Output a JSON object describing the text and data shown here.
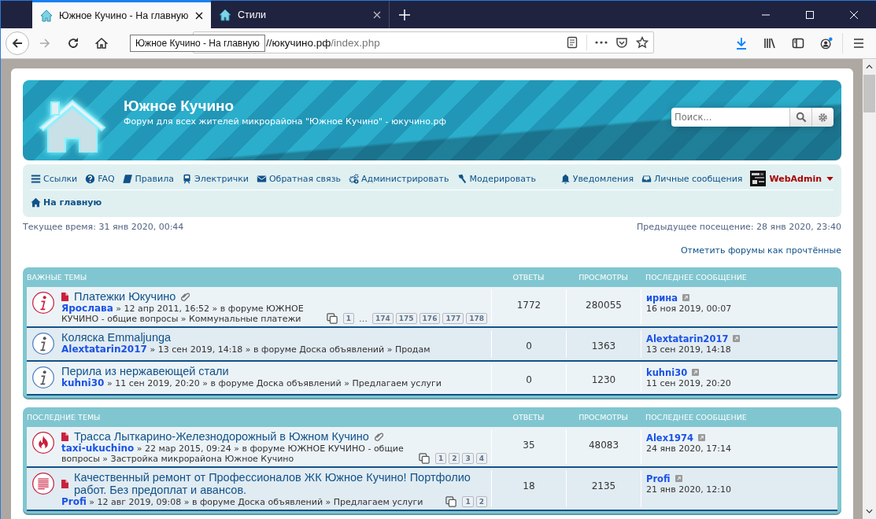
{
  "browser": {
    "tabs": [
      {
        "title": "Южное Кучино - На главную",
        "selected": true
      },
      {
        "title": "Стили",
        "selected": false
      }
    ],
    "url_host": "//юкучино.рф",
    "url_path": "/index.php",
    "tooltip": "Южное Кучино - На главную"
  },
  "site": {
    "title": "Южное Кучино",
    "subtitle": "Форум для всех жителей микрорайона \"Южное Кучино\" - юкучино.рф",
    "search_placeholder": "Поиск..."
  },
  "nav": {
    "left": [
      {
        "label": "Ссылки"
      },
      {
        "label": "FAQ"
      },
      {
        "label": "Правила"
      },
      {
        "label": "Электрички"
      },
      {
        "label": "Обратная связь"
      },
      {
        "label": "Администрировать"
      },
      {
        "label": "Модерировать"
      }
    ],
    "right": [
      {
        "label": "Уведомления"
      },
      {
        "label": "Личные сообщения"
      }
    ],
    "user": "WebAdmin",
    "breadcrumb": "На главную"
  },
  "current_time": "Текущее время: 31 янв 2020, 00:44",
  "last_visit": "Предыдущее посещение: 28 янв 2020, 23:40",
  "mark_read": "Отметить форумы как прочтённые",
  "sections": [
    {
      "title": "ВАЖНЫЕ ТЕМЫ",
      "columns": [
        "ОТВЕТЫ",
        "ПРОСМОТРЫ",
        "ПОСЛЕДНЕЕ СООБЩЕНИЕ"
      ],
      "topics": [
        {
          "kind": "info",
          "unread": true,
          "attachment": true,
          "title": "Платежки Юкучино",
          "author": "Ярослава",
          "meta": "» 12 апр 2011, 16:52 » в форуме ЮЖНОЕ КУЧИНО - общие вопросы » Коммунальные платежи",
          "pages": [
            {
              "kind": "page",
              "label": "1"
            },
            {
              "kind": "ellipsis",
              "label": "…"
            },
            {
              "kind": "page",
              "label": "174"
            },
            {
              "kind": "page",
              "label": "175"
            },
            {
              "kind": "page",
              "label": "176"
            },
            {
              "kind": "page",
              "label": "177"
            },
            {
              "kind": "page",
              "label": "178"
            }
          ],
          "replies": "1772",
          "views": "280055",
          "last_author": "ирина",
          "last_date": "16 ноя 2019, 00:07"
        },
        {
          "kind": "info",
          "unread": false,
          "attachment": false,
          "title": "Коляска Emmaljunga",
          "author": "Alextatarin2017",
          "meta": "» 13 сен 2019, 14:18 » в форуме Доска объявлений » Продам",
          "replies": "0",
          "views": "1363",
          "last_author": "Alextatarin2017",
          "last_date": "13 сен 2019, 14:18"
        },
        {
          "kind": "info",
          "unread": false,
          "attachment": false,
          "title": "Перила из нержавеющей стали",
          "author": "kuhni30",
          "meta": "» 11 сен 2019, 20:20 » в форуме Доска объявлений » Предлагаем услуги",
          "replies": "0",
          "views": "1230",
          "last_author": "kuhni30",
          "last_date": "11 сен 2019, 20:20"
        }
      ]
    },
    {
      "title": "ПОСЛЕДНИЕ ТЕМЫ",
      "columns": [
        "ОТВЕТЫ",
        "ПРОСМОТРЫ",
        "ПОСЛЕДНЕЕ СООБЩЕНИЕ"
      ],
      "topics": [
        {
          "kind": "fire",
          "unread": true,
          "attachment": true,
          "title": "Трасса Лыткарино-Железнодорожный в Южном Кучино",
          "author": "taxi-ukuchino",
          "meta": "» 22 мар 2015, 09:24 » в форуме ЮЖНОЕ КУЧИНО - общие вопросы » Застройка микрорайона Южное Кучино",
          "pages": [
            {
              "kind": "page",
              "label": "1"
            },
            {
              "kind": "page",
              "label": "2"
            },
            {
              "kind": "page",
              "label": "3"
            },
            {
              "kind": "page",
              "label": "4"
            }
          ],
          "replies": "35",
          "views": "48083",
          "last_author": "Alex1974",
          "last_date": "24 янв 2020, 17:14"
        },
        {
          "kind": "lines",
          "unread": true,
          "attachment": false,
          "title": "Качественный ремонт от Профессионалов ЖК Южное Кучино! Портфолио работ. Без предоплат и авансов.",
          "author": "Profi",
          "meta": "» 12 авг 2019, 09:08 » в форуме Доска объявлений » Предлагаем услуги",
          "pages": [
            {
              "kind": "page",
              "label": "1"
            },
            {
              "kind": "page",
              "label": "2"
            }
          ],
          "replies": "18",
          "views": "2135",
          "last_author": "Profi",
          "last_date": "21 янв 2020, 12:10"
        }
      ]
    }
  ]
}
